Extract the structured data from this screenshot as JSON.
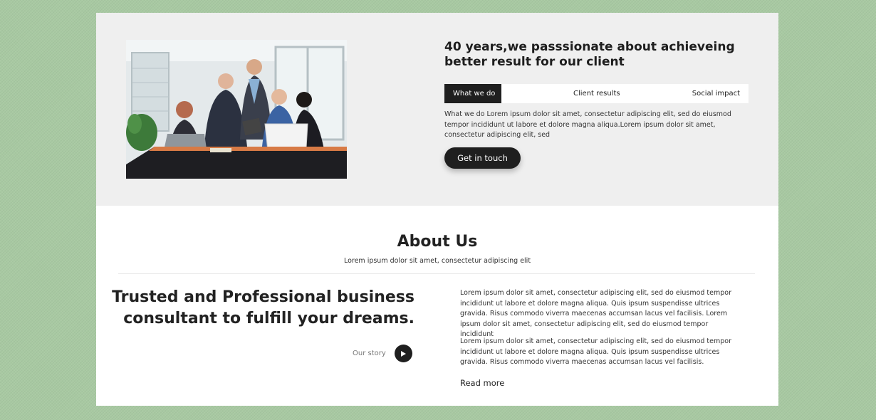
{
  "hero": {
    "title": "40 years,we passsionate about achieveing better result for our client",
    "tabs": [
      {
        "label": "What we do",
        "active": true
      },
      {
        "label": "Client results",
        "active": false
      },
      {
        "label": "Social impact",
        "active": false
      }
    ],
    "text": "What we do Lorem ipsum dolor sit amet, consectetur adipiscing elit, sed do eiusmod tempor incididunt ut labore et dolore magna aliqua.Lorem ipsum dolor sit amet, consectetur adipiscing elit, sed",
    "button": "Get in touch"
  },
  "about": {
    "title": "About Us",
    "subtitle": "Lorem ipsum dolor sit amet, consectetur adipiscing elit",
    "heading": "Trusted and Professional business consultant to fulfill your dreams.",
    "story_label": "Our story",
    "paragraphs": [
      "Lorem ipsum dolor sit amet, consectetur adipiscing elit, sed do eiusmod tempor incididunt ut labore et dolore magna aliqua. Quis ipsum suspendisse ultrices gravida. Risus commodo viverra maecenas accumsan lacus vel facilisis. Lorem ipsum dolor sit amet, consectetur adipiscing elit, sed do eiusmod tempor incididunt",
      "Lorem ipsum dolor sit amet, consectetur adipiscing elit, sed do eiusmod tempor incididunt ut labore et dolore magna aliqua. Quis ipsum suspendisse ultrices gravida. Risus commodo viverra maecenas accumsan lacus vel facilisis."
    ],
    "read_more": "Read more"
  },
  "colors": {
    "background": "#a8c9a2",
    "hero_bg": "#efefef",
    "dark": "#1f1f1f"
  },
  "icons": {
    "play": "play-icon"
  }
}
